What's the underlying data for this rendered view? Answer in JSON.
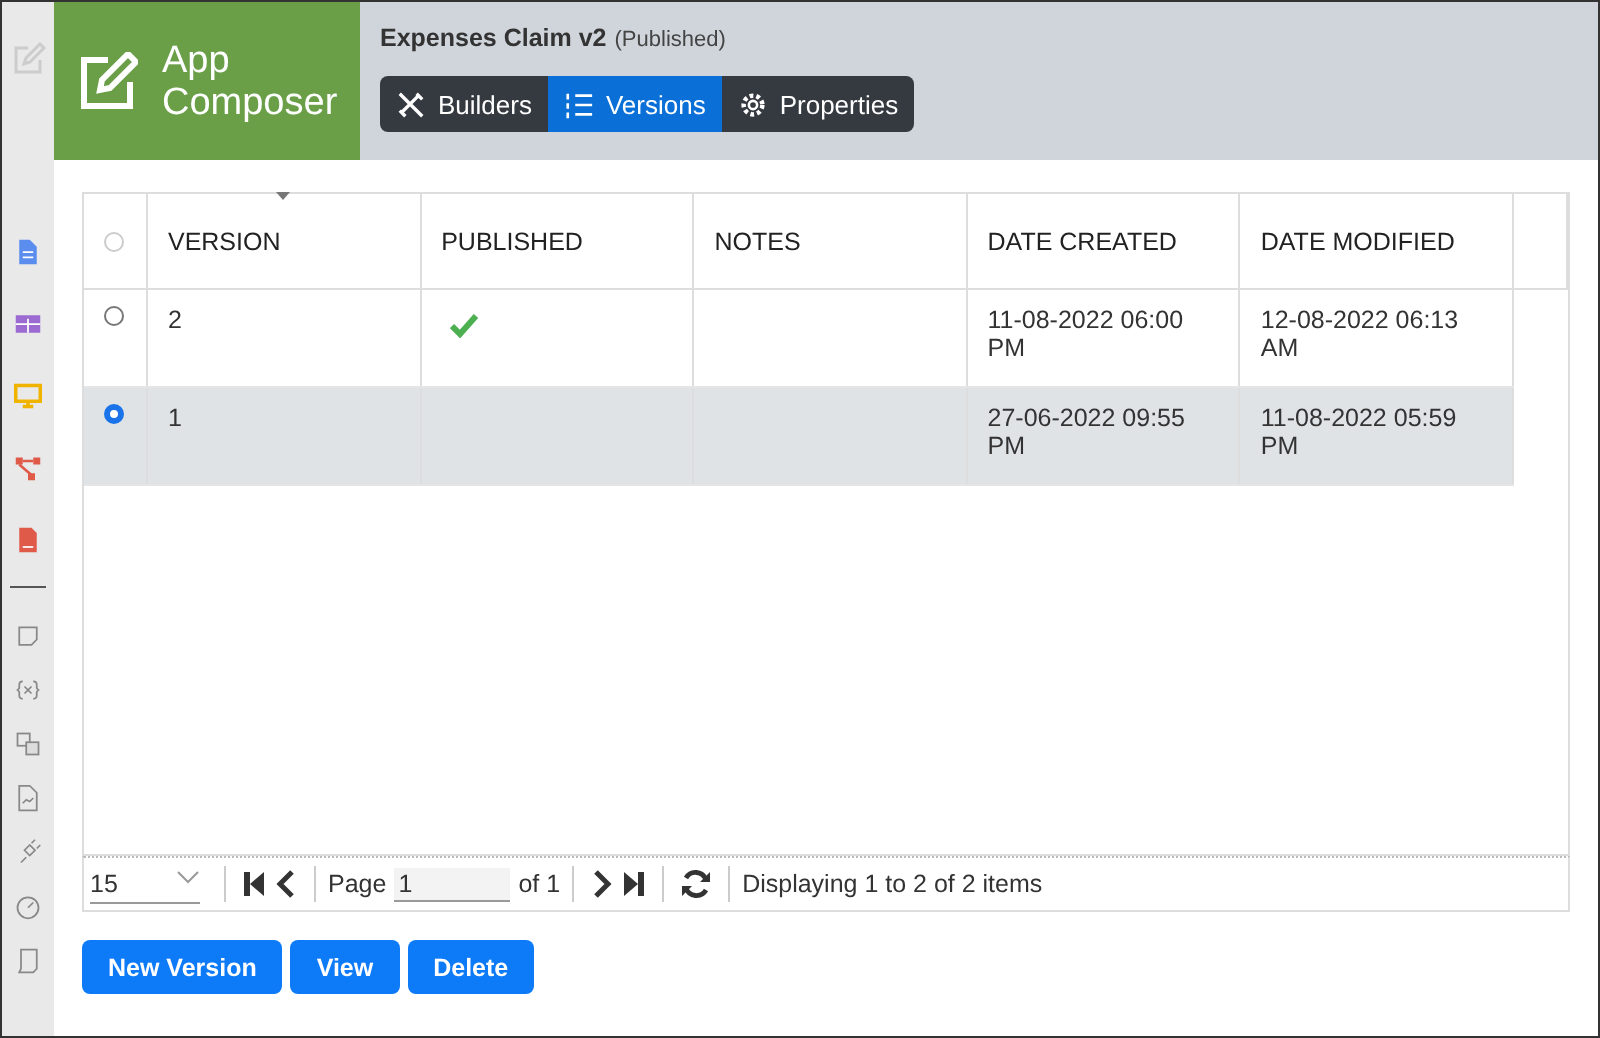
{
  "app_title": "App Composer",
  "document": {
    "title": "Expenses Claim v2",
    "status": "(Published)"
  },
  "tabs": [
    {
      "label": "Builders",
      "selected": false
    },
    {
      "label": "Versions",
      "selected": true
    },
    {
      "label": "Properties",
      "selected": false
    }
  ],
  "table": {
    "select_all_disabled": true,
    "columns": [
      "VERSION",
      "PUBLISHED",
      "NOTES",
      "DATE CREATED",
      "DATE MODIFIED"
    ],
    "rows": [
      {
        "selected": false,
        "version": "2",
        "published": true,
        "date_created": "11-08-2022 06:00 PM",
        "date_modified": "12-08-2022 06:13 AM"
      },
      {
        "selected": true,
        "version": "1",
        "published": false,
        "date_created": "27-06-2022 09:55 PM",
        "date_modified": "11-08-2022 05:59 PM"
      }
    ]
  },
  "pager": {
    "page_size": "15",
    "page_label": "Page",
    "page": "1",
    "page_count": "of 1",
    "summary": "Displaying 1 to 2 of 2 items"
  },
  "buttons": [
    "New Version",
    "View",
    "Delete"
  ]
}
